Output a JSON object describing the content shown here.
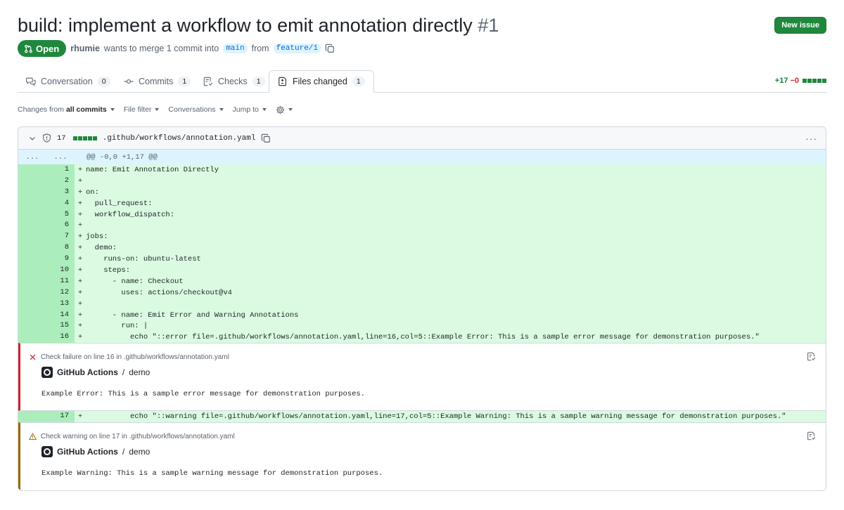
{
  "header": {
    "title": "build: implement a workflow to emit annotation directly",
    "number": "#1",
    "new_issue_label": "New issue"
  },
  "pr_meta": {
    "state": "Open",
    "author": "rhumie",
    "text_mid": "wants to merge 1 commit into",
    "base_branch": "main",
    "text_from": "from",
    "head_branch": "feature/1"
  },
  "tabs": [
    {
      "label": "Conversation",
      "count": "0",
      "icon": "comment-discussion-icon"
    },
    {
      "label": "Commits",
      "count": "1",
      "icon": "commit-icon"
    },
    {
      "label": "Checks",
      "count": "1",
      "icon": "checklist-icon"
    },
    {
      "label": "Files changed",
      "count": "1",
      "icon": "file-diff-icon",
      "active": true
    }
  ],
  "diffstat": {
    "additions": "+17",
    "deletions": "−0"
  },
  "toolbar": {
    "changes_prefix": "Changes from",
    "changes_value": "all commits",
    "file_filter": "File filter",
    "conversations": "Conversations",
    "jump_to": "Jump to"
  },
  "file": {
    "change_count": "17",
    "path": ".github/workflows/annotation.yaml",
    "hunk_old": "...",
    "hunk_new": "...",
    "hunk_header": "@@ -0,0 +1,17 @@"
  },
  "annotations": {
    "error": {
      "title": "Check failure on line 16 in .github/workflows/annotation.yaml",
      "app": "GitHub Actions",
      "sep": "/",
      "job": "demo",
      "message": "Example Error: This is a sample error message for demonstration purposes."
    },
    "warning": {
      "title": "Check warning on line 17 in .github/workflows/annotation.yaml",
      "app": "GitHub Actions",
      "sep": "/",
      "job": "demo",
      "message": "Example Warning: This is a sample warning message for demonstration purposes."
    }
  },
  "lines": {
    "l1": {
      "n": "1",
      "code": "name: Emit Annotation Directly"
    },
    "l2": {
      "n": "2",
      "code": ""
    },
    "l3": {
      "n": "3",
      "code": "on:"
    },
    "l4": {
      "n": "4",
      "code": "  pull_request:"
    },
    "l5": {
      "n": "5",
      "code": "  workflow_dispatch:"
    },
    "l6": {
      "n": "6",
      "code": ""
    },
    "l7": {
      "n": "7",
      "code": "jobs:"
    },
    "l8": {
      "n": "8",
      "code": "  demo:"
    },
    "l9": {
      "n": "9",
      "code": "    runs-on: ubuntu-latest"
    },
    "l10": {
      "n": "10",
      "code": "    steps:"
    },
    "l11": {
      "n": "11",
      "code": "      - name: Checkout"
    },
    "l12": {
      "n": "12",
      "code": "        uses: actions/checkout@v4"
    },
    "l13": {
      "n": "13",
      "code": ""
    },
    "l14": {
      "n": "14",
      "code": "      - name: Emit Error and Warning Annotations"
    },
    "l15": {
      "n": "15",
      "code": "        run: |"
    },
    "l16": {
      "n": "16",
      "code": "          echo \"::error file=.github/workflows/annotation.yaml,line=16,col=5::Example Error: This is a sample error message for demonstration purposes.\""
    },
    "l17": {
      "n": "17",
      "code": "          echo \"::warning file=.github/workflows/annotation.yaml,line=17,col=5::Example Warning: This is a sample warning message for demonstration purposes.\""
    }
  },
  "sign": "+"
}
